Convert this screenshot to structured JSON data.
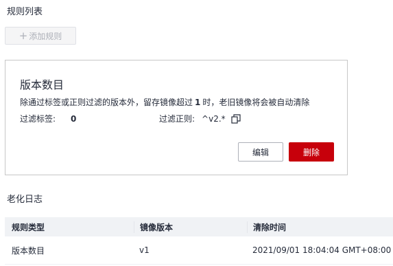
{
  "rules": {
    "section_title": "规则列表",
    "add_button_label": "添加规则",
    "add_icon": "plus-icon"
  },
  "card": {
    "title": "版本数目",
    "desc_prefix": "除通过标签或正则过滤的版本外，留存镜像超过",
    "desc_count": "1",
    "desc_suffix": "时，老旧镜像将会被自动清除",
    "tag_filter_label": "过滤标签:",
    "tag_filter_value": "0",
    "regex_filter_label": "过滤正则:",
    "regex_filter_value": "^v2.*",
    "copy_icon": "copy-icon",
    "edit_label": "编辑",
    "delete_label": "删除"
  },
  "log": {
    "section_title": "老化日志",
    "columns": [
      "规则类型",
      "镜像版本",
      "清除时间"
    ],
    "rows": [
      [
        "版本数目",
        "v1",
        "2021/09/01 18:04:04 GMT+08:00"
      ]
    ]
  },
  "colors": {
    "danger": "#c7000b",
    "header_bg": "#f0f2f5",
    "border": "#c7c7c7"
  }
}
